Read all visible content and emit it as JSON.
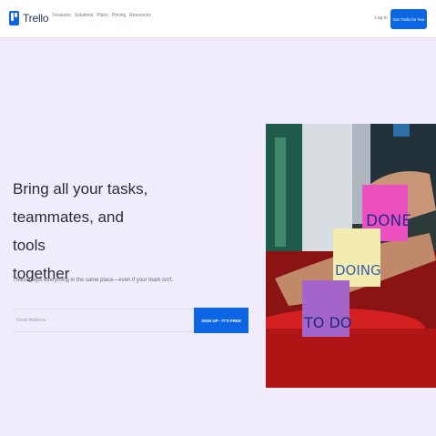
{
  "nav": {
    "brand": "Trello",
    "links": [
      "Features",
      "Solutions",
      "Plans",
      "Pricing",
      "Resources"
    ],
    "login": "Log in",
    "cta": "Get Trello for free"
  },
  "hero": {
    "headline_lines": [
      "Bring all your tasks,",
      "teammates, and tools",
      "together"
    ],
    "subtext": "Trello keeps everything in the same place—even if your team isn't.",
    "email_placeholder": "Email Address",
    "signup_label": "SIGN UP - IT'S FREE",
    "notes": [
      "DONE",
      "DOING",
      "TO DO"
    ]
  },
  "colors": {
    "brand_blue": "#0c66e4",
    "page_bg": "#f0ecfb",
    "note_done": "#ec4fbf",
    "note_doing": "#f2ecaf",
    "note_todo": "#a365c9"
  }
}
